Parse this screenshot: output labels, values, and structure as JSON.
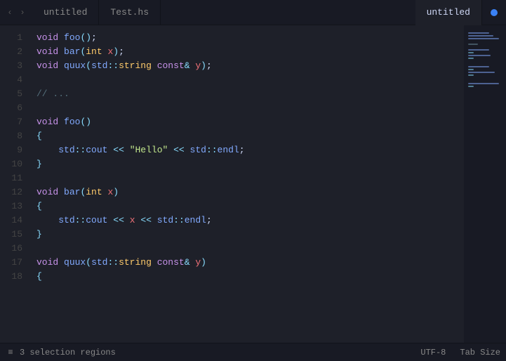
{
  "tabs": [
    {
      "label": "untitled",
      "active": false
    },
    {
      "label": "Test.hs",
      "active": false
    },
    {
      "label": "untitled",
      "active": true
    }
  ],
  "nav": {
    "back": "‹",
    "forward": "›"
  },
  "code_lines": [
    {
      "num": 1,
      "content": "void foo();"
    },
    {
      "num": 2,
      "content": "void bar(int x);"
    },
    {
      "num": 3,
      "content": "void quux(std::string const& y);"
    },
    {
      "num": 4,
      "content": ""
    },
    {
      "num": 5,
      "content": "// ..."
    },
    {
      "num": 6,
      "content": ""
    },
    {
      "num": 7,
      "content": "void foo()"
    },
    {
      "num": 8,
      "content": "{"
    },
    {
      "num": 9,
      "content": "    std::cout << \"Hello\" << std::endl;"
    },
    {
      "num": 10,
      "content": "}"
    },
    {
      "num": 11,
      "content": ""
    },
    {
      "num": 12,
      "content": "void bar(int x)"
    },
    {
      "num": 13,
      "content": "{"
    },
    {
      "num": 14,
      "content": "    std::cout << x << std::endl;"
    },
    {
      "num": 15,
      "content": "}"
    },
    {
      "num": 16,
      "content": ""
    },
    {
      "num": 17,
      "content": "void quux(std::string const& y)"
    },
    {
      "num": 18,
      "content": "{"
    }
  ],
  "status": {
    "selection_icon": "≡",
    "selection_text": "3 selection regions",
    "encoding": "UTF-8",
    "tab_size": "Tab Size"
  }
}
